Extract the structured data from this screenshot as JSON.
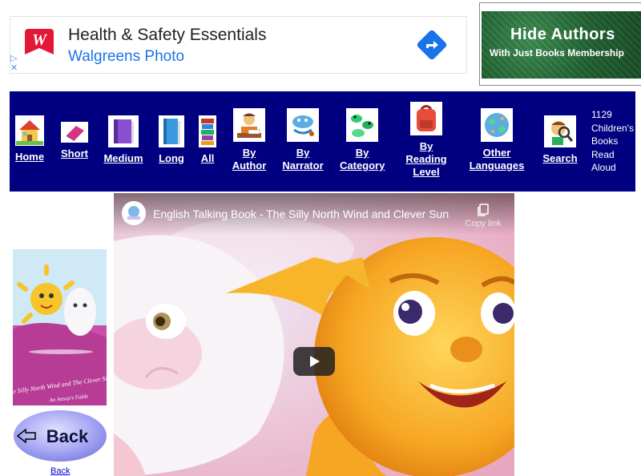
{
  "ad": {
    "title": "Health & Safety Essentials",
    "subtitle": "Walgreens Photo",
    "brand_color": "#e31837",
    "link_color": "#1a73e8",
    "choice_icon": "ad-choices-icon",
    "close_icon": "close-icon"
  },
  "ad_right": {
    "line1": "Hide Authors",
    "line2": "With Just Books Membership"
  },
  "nav": {
    "background": "#000080",
    "items": [
      {
        "label": "Home",
        "icon": "house-icon"
      },
      {
        "label": "Short",
        "icon": "pink-book-icon"
      },
      {
        "label": "Medium",
        "icon": "purple-book-icon"
      },
      {
        "label": "Long",
        "icon": "blue-book-icon"
      },
      {
        "label": "All",
        "icon": "book-stack-icon"
      },
      {
        "label": "By Author",
        "icon": "author-writing-icon"
      },
      {
        "label": "By Narrator",
        "icon": "narrator-icon"
      },
      {
        "label": "By Category",
        "icon": "frogs-icon"
      },
      {
        "label": "By Reading Level",
        "icon": "backpack-icon"
      },
      {
        "label": "Other Languages",
        "icon": "globe-icon"
      },
      {
        "label": "Search",
        "icon": "magnifier-kid-icon"
      }
    ],
    "count_text": "1129 Children's Books Read Aloud"
  },
  "sidebar": {
    "cover_alt": "book-cover",
    "back_button_label": "Back",
    "back_link": "Back"
  },
  "video": {
    "title": "English Talking Book - The Silly North Wind and Clever Sun",
    "copy_label": "Copy link"
  }
}
